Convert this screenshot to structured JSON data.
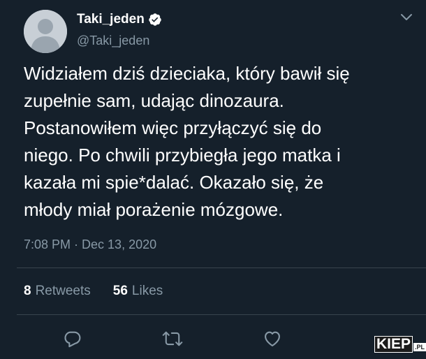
{
  "user": {
    "display_name": "Taki_jeden",
    "handle": "@Taki_jeden"
  },
  "tweet": {
    "text": "Widziałem dziś dzieciaka, który bawił się\nzupełnie sam, udając dinozaura.\nPostanowiłem więc przyłączyć się do\nniego. Po chwili przybiegła jego matka i\nkazała mi spie*dalać. Okazało się, że\nmłody miał porażenie mózgowe.",
    "timestamp": "7:08 PM · Dec 13, 2020"
  },
  "stats": {
    "retweets_count": "8",
    "retweets_label": "Retweets",
    "likes_count": "56",
    "likes_label": "Likes"
  },
  "icons": {
    "verified": "verified-badge-icon",
    "menu": "chevron-down-icon",
    "reply": "reply-icon",
    "retweet": "retweet-icon",
    "like": "heart-icon"
  },
  "watermark": {
    "main": "KIEP",
    "suffix": ".PL"
  },
  "colors": {
    "background": "#15202b",
    "text_primary": "#ffffff",
    "text_secondary": "#8899a6",
    "divider": "#38444d"
  }
}
